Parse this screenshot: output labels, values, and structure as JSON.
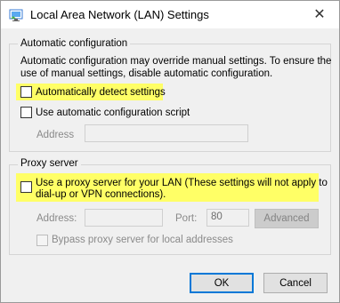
{
  "window": {
    "title": "Local Area Network (LAN) Settings",
    "close_glyph": "✕"
  },
  "auto_config": {
    "legend": "Automatic configuration",
    "description_line1": "Automatic configuration may override manual settings.  To ensure the",
    "description_line2": "use of manual settings, disable automatic configuration.",
    "auto_detect_label": "Automatically detect settings",
    "auto_detect_checked": false,
    "script_label": "Use automatic configuration script",
    "script_checked": false,
    "address_label": "Address",
    "address_value": ""
  },
  "proxy": {
    "legend": "Proxy server",
    "use_proxy_line1": "Use a proxy server for your LAN (These settings will not apply to",
    "use_proxy_line2": "dial-up or VPN connections).",
    "use_proxy_checked": false,
    "address_label": "Address:",
    "address_value": "",
    "port_label": "Port:",
    "port_value": "80",
    "advanced_label": "Advanced",
    "bypass_label": "Bypass proxy server for local addresses",
    "bypass_checked": false
  },
  "buttons": {
    "ok_label": "OK",
    "cancel_label": "Cancel"
  },
  "colors": {
    "highlight": "#ffff66",
    "default_button_border": "#0078d7"
  },
  "icons": {
    "title_icon": "network-settings-icon",
    "close_icon": "close-icon"
  }
}
